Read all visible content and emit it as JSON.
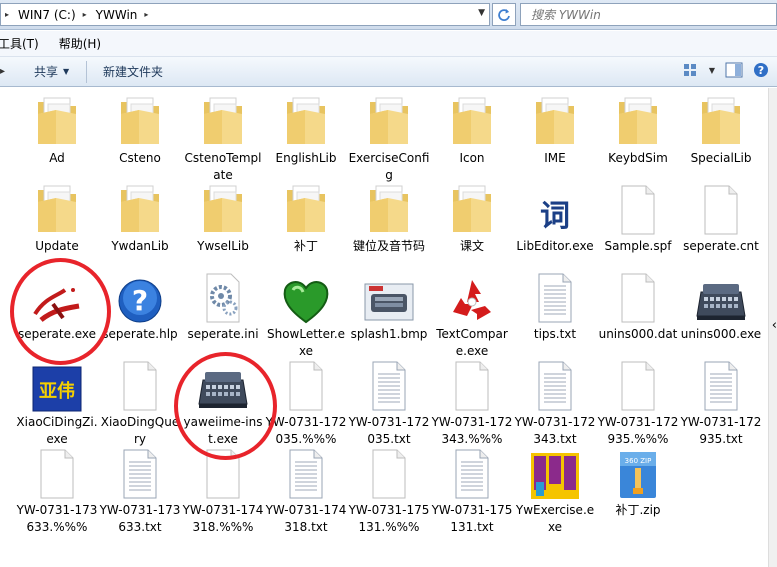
{
  "address": {
    "crumbs": [
      "WIN7 (C:)",
      "YWWin"
    ],
    "search_placeholder": "搜索 YWWin"
  },
  "menu": [
    "工具(T)",
    "帮助(H)"
  ],
  "commands": {
    "share": "共享",
    "new_folder": "新建文件夹"
  },
  "items": [
    {
      "label": "Ad",
      "type": "folder"
    },
    {
      "label": "Csteno",
      "type": "folder"
    },
    {
      "label": "CstenoTemplate",
      "type": "folder"
    },
    {
      "label": "EnglishLib",
      "type": "folder"
    },
    {
      "label": "ExerciseConfig",
      "type": "folder"
    },
    {
      "label": "Icon",
      "type": "folder"
    },
    {
      "label": "IME",
      "type": "folder"
    },
    {
      "label": "KeybdSim",
      "type": "folder"
    },
    {
      "label": "SpecialLib",
      "type": "folder"
    },
    {
      "label": "Update",
      "type": "folder"
    },
    {
      "label": "YwdanLib",
      "type": "folder"
    },
    {
      "label": "YwselLib",
      "type": "folder"
    },
    {
      "label": "补丁",
      "type": "folder"
    },
    {
      "label": "键位及音节码",
      "type": "folder"
    },
    {
      "label": "课文",
      "type": "folder"
    },
    {
      "label": "LibEditor.exe",
      "type": "libeditor",
      "glyph": "词"
    },
    {
      "label": "Sample.spf",
      "type": "blank"
    },
    {
      "label": "seperate.cnt",
      "type": "blank"
    },
    {
      "label": "seperate.exe",
      "type": "seperate-exe"
    },
    {
      "label": "seperate.hlp",
      "type": "help"
    },
    {
      "label": "seperate.ini",
      "type": "ini"
    },
    {
      "label": "ShowLetter.exe",
      "type": "heart"
    },
    {
      "label": "splash1.bmp",
      "type": "bmp"
    },
    {
      "label": "TextCompare.exe",
      "type": "recycle"
    },
    {
      "label": "tips.txt",
      "type": "text"
    },
    {
      "label": "unins000.dat",
      "type": "blank"
    },
    {
      "label": "unins000.exe",
      "type": "machine"
    },
    {
      "label": "XiaoCiDingZi.exe",
      "type": "yawei-logo",
      "glyph": "亚伟"
    },
    {
      "label": "XiaoDingQuery",
      "type": "blank"
    },
    {
      "label": "yaweiime-inst.exe",
      "type": "machine"
    },
    {
      "label": "YW-0731-172035.%%%",
      "type": "blank"
    },
    {
      "label": "YW-0731-172035.txt",
      "type": "text"
    },
    {
      "label": "YW-0731-172343.%%%",
      "type": "blank"
    },
    {
      "label": "YW-0731-172343.txt",
      "type": "text"
    },
    {
      "label": "YW-0731-172935.%%%",
      "type": "blank"
    },
    {
      "label": "YW-0731-172935.txt",
      "type": "text"
    },
    {
      "label": "YW-0731-173633.%%%",
      "type": "blank"
    },
    {
      "label": "YW-0731-173633.txt",
      "type": "text"
    },
    {
      "label": "YW-0731-174318.%%%",
      "type": "blank"
    },
    {
      "label": "YW-0731-174318.txt",
      "type": "text"
    },
    {
      "label": "YW-0731-175131.%%%",
      "type": "blank"
    },
    {
      "label": "YW-0731-175131.txt",
      "type": "text"
    },
    {
      "label": "YwExercise.exe",
      "type": "ywexercise"
    },
    {
      "label": "补丁.zip",
      "type": "zip",
      "glyph": "360 ZIP"
    }
  ],
  "colors": {
    "circle": "#e8242b",
    "folder": "#f2d27a",
    "command_text": "#1e395b"
  }
}
